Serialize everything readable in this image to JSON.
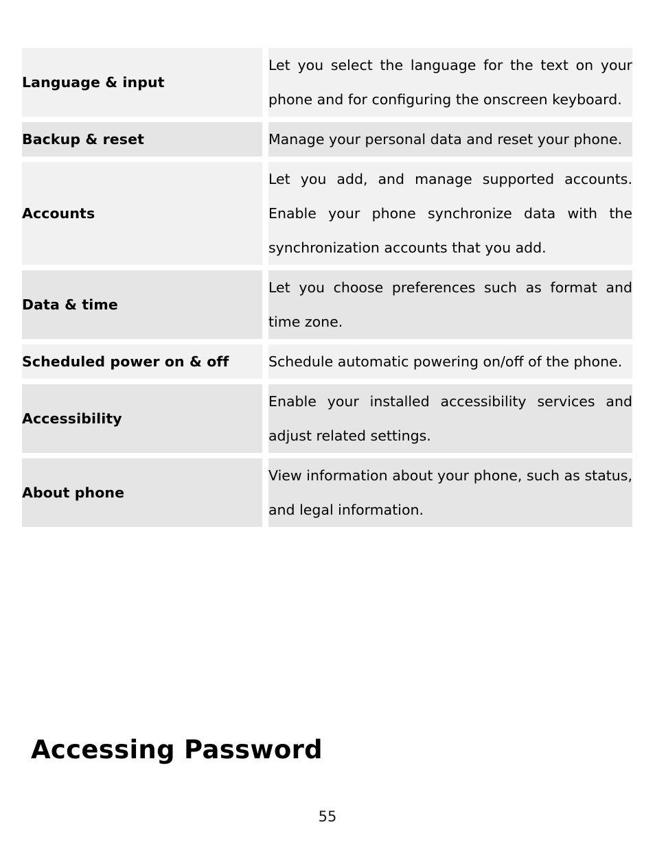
{
  "document": {
    "page_number": "55",
    "heading": "Accessing Password"
  },
  "settings_table": {
    "rows": [
      {
        "label": "Language & input",
        "description": "Let you select the language for the text on your phone and for configuring the onscreen keyboard.",
        "shade": "light",
        "label_lines": 1
      },
      {
        "label": "Backup & reset",
        "description": "Manage your personal data and reset your phone.",
        "shade": "dark",
        "label_lines": 1
      },
      {
        "label": "Accounts",
        "description": "Let you add, and manage supported accounts. Enable your phone synchronize data with the synchronization accounts that you add.",
        "shade": "light",
        "label_lines": 1
      },
      {
        "label": "Data & time",
        "description": "Let you choose preferences such as format and time zone.",
        "shade": "dark",
        "label_lines": 1
      },
      {
        "label": "Scheduled power on & off",
        "description": "Schedule automatic powering on/off of the phone.",
        "shade": "light",
        "label_lines": 2
      },
      {
        "label": "Accessibility",
        "description": "Enable your installed accessibility services and adjust related settings.",
        "shade": "dark",
        "label_lines": 1
      },
      {
        "label": "About phone",
        "description": "View information about your phone, such as status, and legal information.",
        "shade": "dark",
        "label_lines": 1
      }
    ]
  },
  "colors": {
    "row_light": "#f1f1f1",
    "row_dark": "#e5e5e5",
    "page_background": "#ffffff",
    "text": "#000000"
  }
}
